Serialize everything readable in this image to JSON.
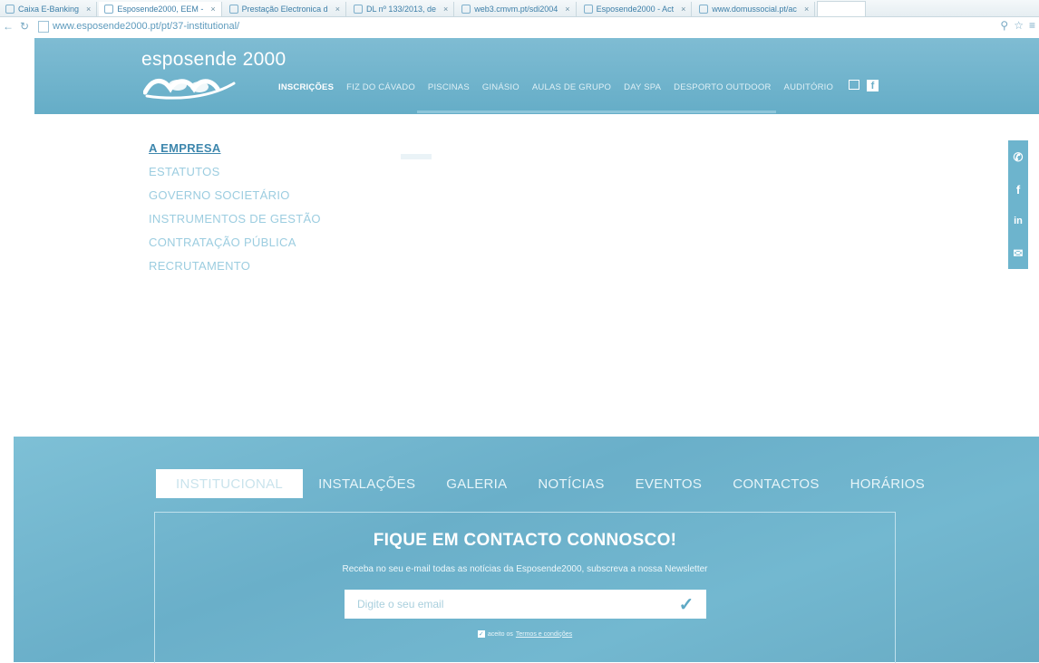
{
  "browser": {
    "tabs": [
      {
        "label": "Caixa E-Banking"
      },
      {
        "label": "Esposende2000, EEM -"
      },
      {
        "label": "Prestação Electronica d"
      },
      {
        "label": "DL nº 133/2013, de"
      },
      {
        "label": "web3.cmvm.pt/sdi2004"
      },
      {
        "label": "Esposende2000 - Act"
      },
      {
        "label": "www.domussocial.pt/ac"
      }
    ],
    "url": "www.esposende2000.pt/pt/37-institutional/"
  },
  "header": {
    "logo_text": "esposende 2000",
    "nav": [
      {
        "label": "INSCRIÇÕES",
        "active": true
      },
      {
        "label": "FIZ DO CÁVADO",
        "active": false
      },
      {
        "label": "PISCINAS",
        "active": false
      },
      {
        "label": "GINÁSIO",
        "active": false
      },
      {
        "label": "AULAS DE GRUPO",
        "active": false
      },
      {
        "label": "DAY SPA",
        "active": false
      },
      {
        "label": "DESPORTO OUTDOOR",
        "active": false
      },
      {
        "label": "AUDITÓRIO",
        "active": false
      }
    ],
    "icons": [
      "email-icon",
      "facebook-icon"
    ]
  },
  "submenu": [
    {
      "label": "A EMPRESA",
      "active": true
    },
    {
      "label": "ESTATUTOS",
      "active": false
    },
    {
      "label": "GOVERNO SOCIETÁRIO",
      "active": false
    },
    {
      "label": "INSTRUMENTOS DE GESTÃO",
      "active": false
    },
    {
      "label": "CONTRATAÇÃO PÚBLICA",
      "active": false
    },
    {
      "label": "RECRUTAMENTO",
      "active": false
    }
  ],
  "social": [
    "phone-icon",
    "facebook-icon",
    "linkedin-icon",
    "email-icon"
  ],
  "footer": {
    "tabs": [
      {
        "label": "INSTITUCIONAL",
        "active": true
      },
      {
        "label": "INSTALAÇÕES",
        "active": false
      },
      {
        "label": "GALERIA",
        "active": false
      },
      {
        "label": "NOTÍCIAS",
        "active": false
      },
      {
        "label": "EVENTOS",
        "active": false
      },
      {
        "label": "CONTACTOS",
        "active": false
      },
      {
        "label": "HORÁRIOS",
        "active": false
      }
    ],
    "newsletter": {
      "title": "FIQUE EM CONTACTO CONNOSCO!",
      "subtitle": "Receba no seu e-mail todas as notícias da Esposende2000, subscreva a nossa Newsletter",
      "email_placeholder": "Digite o seu email",
      "terms_prefix": "aceito os",
      "terms_link": "Termos e condições"
    }
  },
  "colors": {
    "brand": "#6aaec8",
    "submenu_active": "#3e87ad",
    "submenu_inactive": "#9ccde0"
  }
}
